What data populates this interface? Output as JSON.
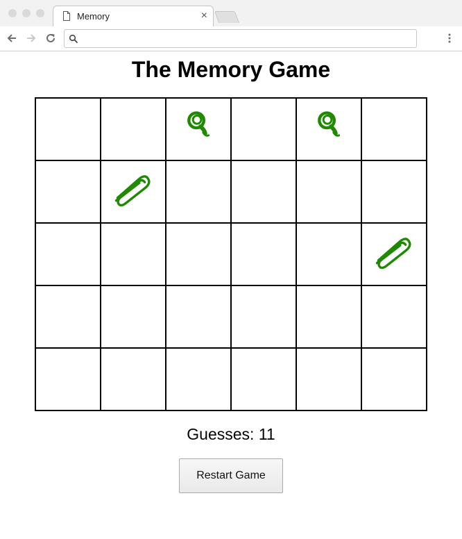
{
  "browser": {
    "tab_title": "Memory",
    "tab_close": "×",
    "address_value": "",
    "icons": {
      "tab": "document-icon",
      "back": "arrow-left-icon",
      "forward": "arrow-right-icon",
      "reload": "reload-icon",
      "search": "search-icon",
      "menu": "kebab-menu-icon"
    }
  },
  "game": {
    "title": "The Memory Game",
    "guesses_label": "Guesses: 11",
    "restart_label": "Restart Game",
    "rows": 5,
    "cols": 6,
    "revealed": [
      {
        "row": 0,
        "col": 2,
        "icon": "magnifier-icon"
      },
      {
        "row": 0,
        "col": 4,
        "icon": "magnifier-icon"
      },
      {
        "row": 1,
        "col": 1,
        "icon": "paperclip-icon"
      },
      {
        "row": 2,
        "col": 5,
        "icon": "paperclip-icon"
      }
    ],
    "icon_color": "#1f8a00"
  }
}
